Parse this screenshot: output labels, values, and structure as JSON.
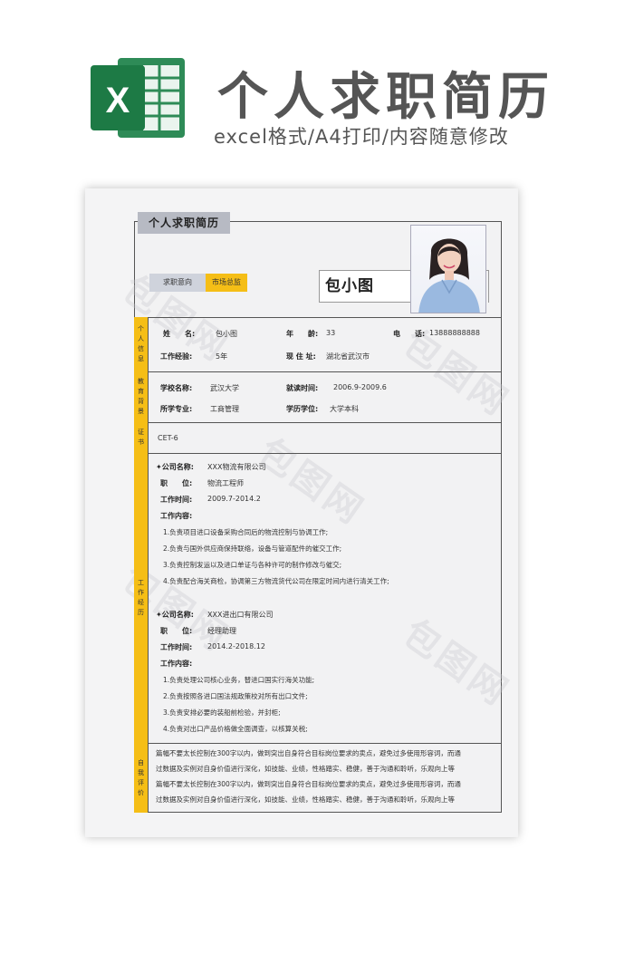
{
  "banner": {
    "title": "个人求职简历",
    "subtitle": "excel格式/A4打印/内容随意修改",
    "logo_letter": "X"
  },
  "resume": {
    "tab_title": "个人求职简历",
    "intent_label": "求职意向",
    "intent_value": "市场总监",
    "display_name": "包小图",
    "personal": {
      "section": [
        "个",
        "人",
        "信",
        "息"
      ],
      "name_label": "姓　　名:",
      "name": "包小图",
      "age_label": "年　　龄:",
      "age": "33",
      "phone_label": "电　　话:",
      "phone": "13888888888",
      "exp_label": "工作经验:",
      "exp": "5年",
      "address_label": "现 住 址:",
      "address": "湖北省武汉市"
    },
    "education": {
      "section": [
        "教",
        "育",
        "背",
        "景"
      ],
      "school_label": "学校名称:",
      "school": "武汉大学",
      "period_label": "就读时间:",
      "period": "2006.9-2009.6",
      "major_label": "所学专业:",
      "major": "工商管理",
      "degree_label": "学历学位:",
      "degree": "大学本科"
    },
    "certificate": {
      "section": [
        "证",
        "书"
      ],
      "value": "CET-6"
    },
    "work": {
      "section": [
        "工",
        "作",
        "经",
        "历"
      ],
      "jobs": [
        {
          "company_label": "✦公司名称:",
          "company": "XXX物流有限公司",
          "position_label": "职　　位:",
          "position": "物流工程师",
          "time_label": "工作时间:",
          "time": "2009.7-2014.2",
          "content_label": "工作内容:",
          "duties": [
            "1.负责项目进口设备采购合同后的物流控制与协调工作;",
            "2.负责与国外供应商保持联络，设备与管道配件的催交工作;",
            "3.负责控制发运以及进口单证与各种许可的制作修改与催交;",
            "4.负责配合海关商检，协调第三方物流货代公司在限定时间内进行清关工作;"
          ]
        },
        {
          "company_label": "✦公司名称:",
          "company": "XXX进出口有限公司",
          "position_label": "职　　位:",
          "position": "经理助理",
          "time_label": "工作时间:",
          "time": "2014.2-2018.12",
          "content_label": "工作内容:",
          "duties": [
            "1.负责处理公司核心业务，替进口国实行海关功能;",
            "2.负责按照各进口国法规政策校对所有出口文件;",
            "3.负责安排必要的装船前检验，并封柜;",
            "4.负责对出口产品价格做全面调查，以核算关税;"
          ]
        }
      ]
    },
    "self": {
      "section": [
        "自",
        "我",
        "评",
        "价"
      ],
      "lines": [
        "篇幅不要太长控制在300字以内，做到突出自身符合目标岗位要求的卖点，避免过多使用形容词，而通",
        "过数据及实例对自身价值进行深化，如技能、业绩，性格踏实、稳健，善于沟通和聆听，乐观向上等",
        "篇幅不要太长控制在300字以内，做到突出自身符合目标岗位要求的卖点，避免过多使用形容词，而通",
        "过数据及实例对自身价值进行深化，如技能、业绩，性格踏实、稳健，善于沟通和聆听，乐观向上等"
      ]
    }
  },
  "watermark": "包图网",
  "colors": {
    "accent": "#f5be16",
    "excel_green": "#1d7a45",
    "tab": "#b7bac3"
  }
}
